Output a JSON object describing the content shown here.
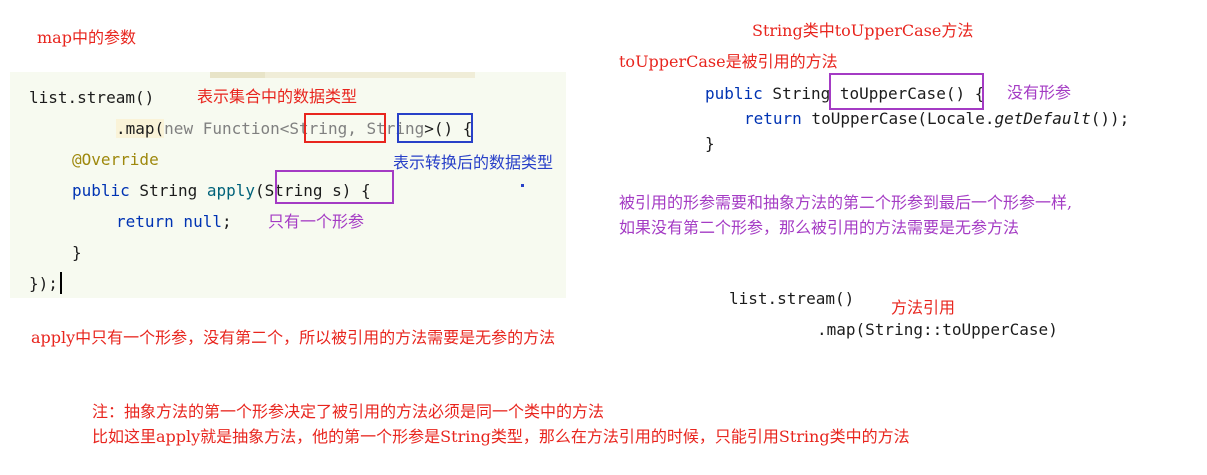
{
  "left": {
    "heading": "map中的参数",
    "code": {
      "line1": "list.stream()",
      "line2_prefix": ".map(",
      "line2_new": "new",
      "line2_fn": " Function<",
      "line2_type1": "String",
      "line2_comma": ", ",
      "line2_type2": "String",
      "line2_suffix": ">() {",
      "line3": "@Override",
      "line4_kw": "public",
      "line4_rest": " String ",
      "line4_method": "apply",
      "line4_params": "(String s)",
      "line4_end": " {",
      "line5_kw": "return",
      "line5_null": " null",
      "line5_end": ";",
      "line6": "}",
      "line7": "});"
    },
    "label_input_type": "表示集合中的数据类型",
    "label_output_type": "表示转换后的数据类型",
    "label_one_param": "只有一个形参",
    "summary": "apply中只有一个形参，没有第二个，所以被引用的方法需要是无参的方法"
  },
  "right": {
    "heading": "String类中toUpperCase方法",
    "subheading": "toUpperCase是被引用的方法",
    "code": {
      "line1_kw": "public",
      "line1_type": " String ",
      "line1_sig": "toUpperCase()",
      "line1_end": " {",
      "line2_kw": "return",
      "line2_call": " toUpperCase(Locale.",
      "line2_italic": "getDefault",
      "line2_end": "());",
      "line3": "}"
    },
    "label_no_param": "没有形参",
    "rule_line1": "被引用的形参需要和抽象方法的第二个形参到最后一个形参一样,",
    "rule_line2": "如果没有第二个形参，那么被引用的方法需要是无参方法",
    "ref_code_line1": "list.stream()",
    "ref_code_line2": ".map(String::toUpperCase)",
    "ref_label": "方法引用"
  },
  "note": {
    "line1": "注：抽象方法的第一个形参决定了被引用的方法必须是同一个类中的方法",
    "line2": "比如这里apply就是抽象方法，他的第一个形参是String类型，那么在方法引用的时候，只能引用String类中的方法"
  },
  "colors": {
    "red": "#e8251e",
    "blue": "#2840c8",
    "purple": "#a43bc4"
  }
}
